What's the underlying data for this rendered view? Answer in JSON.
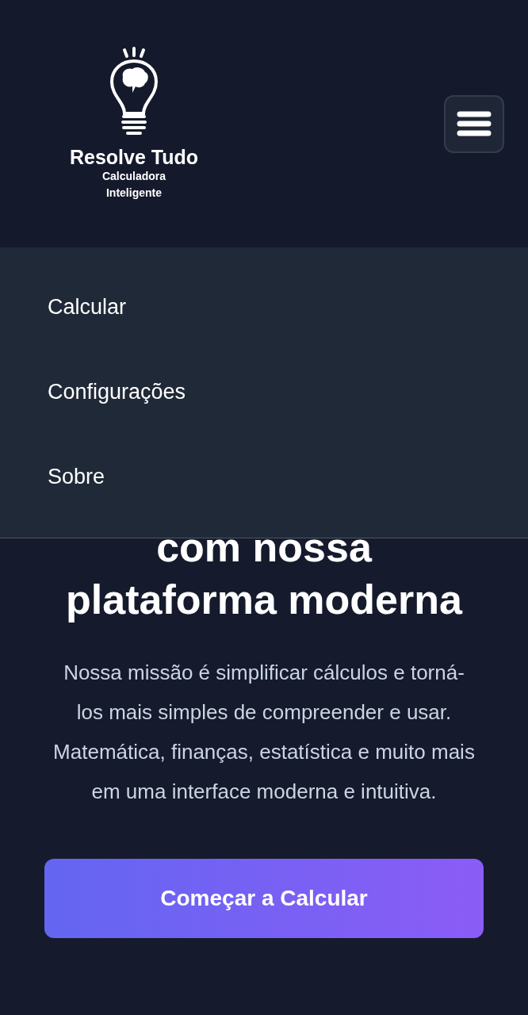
{
  "header": {
    "logo_title": "Resolve Tudo",
    "logo_subtitle": "Calculadora Inteligente",
    "menu_expanded": true
  },
  "menu": {
    "items": [
      {
        "label": "Calcular"
      },
      {
        "label": "Configurações"
      },
      {
        "label": "Sobre"
      }
    ]
  },
  "hero": {
    "heading_lines": [
      "com nossa",
      "plataforma moderna"
    ],
    "description": "Nossa missão é simplificar cálculos e torná-los mais simples de compreender e usar. Matemática, finanças, estatística e muito mais em uma interface moderna e intuitiva.",
    "cta": "Começar a Calcular"
  }
}
